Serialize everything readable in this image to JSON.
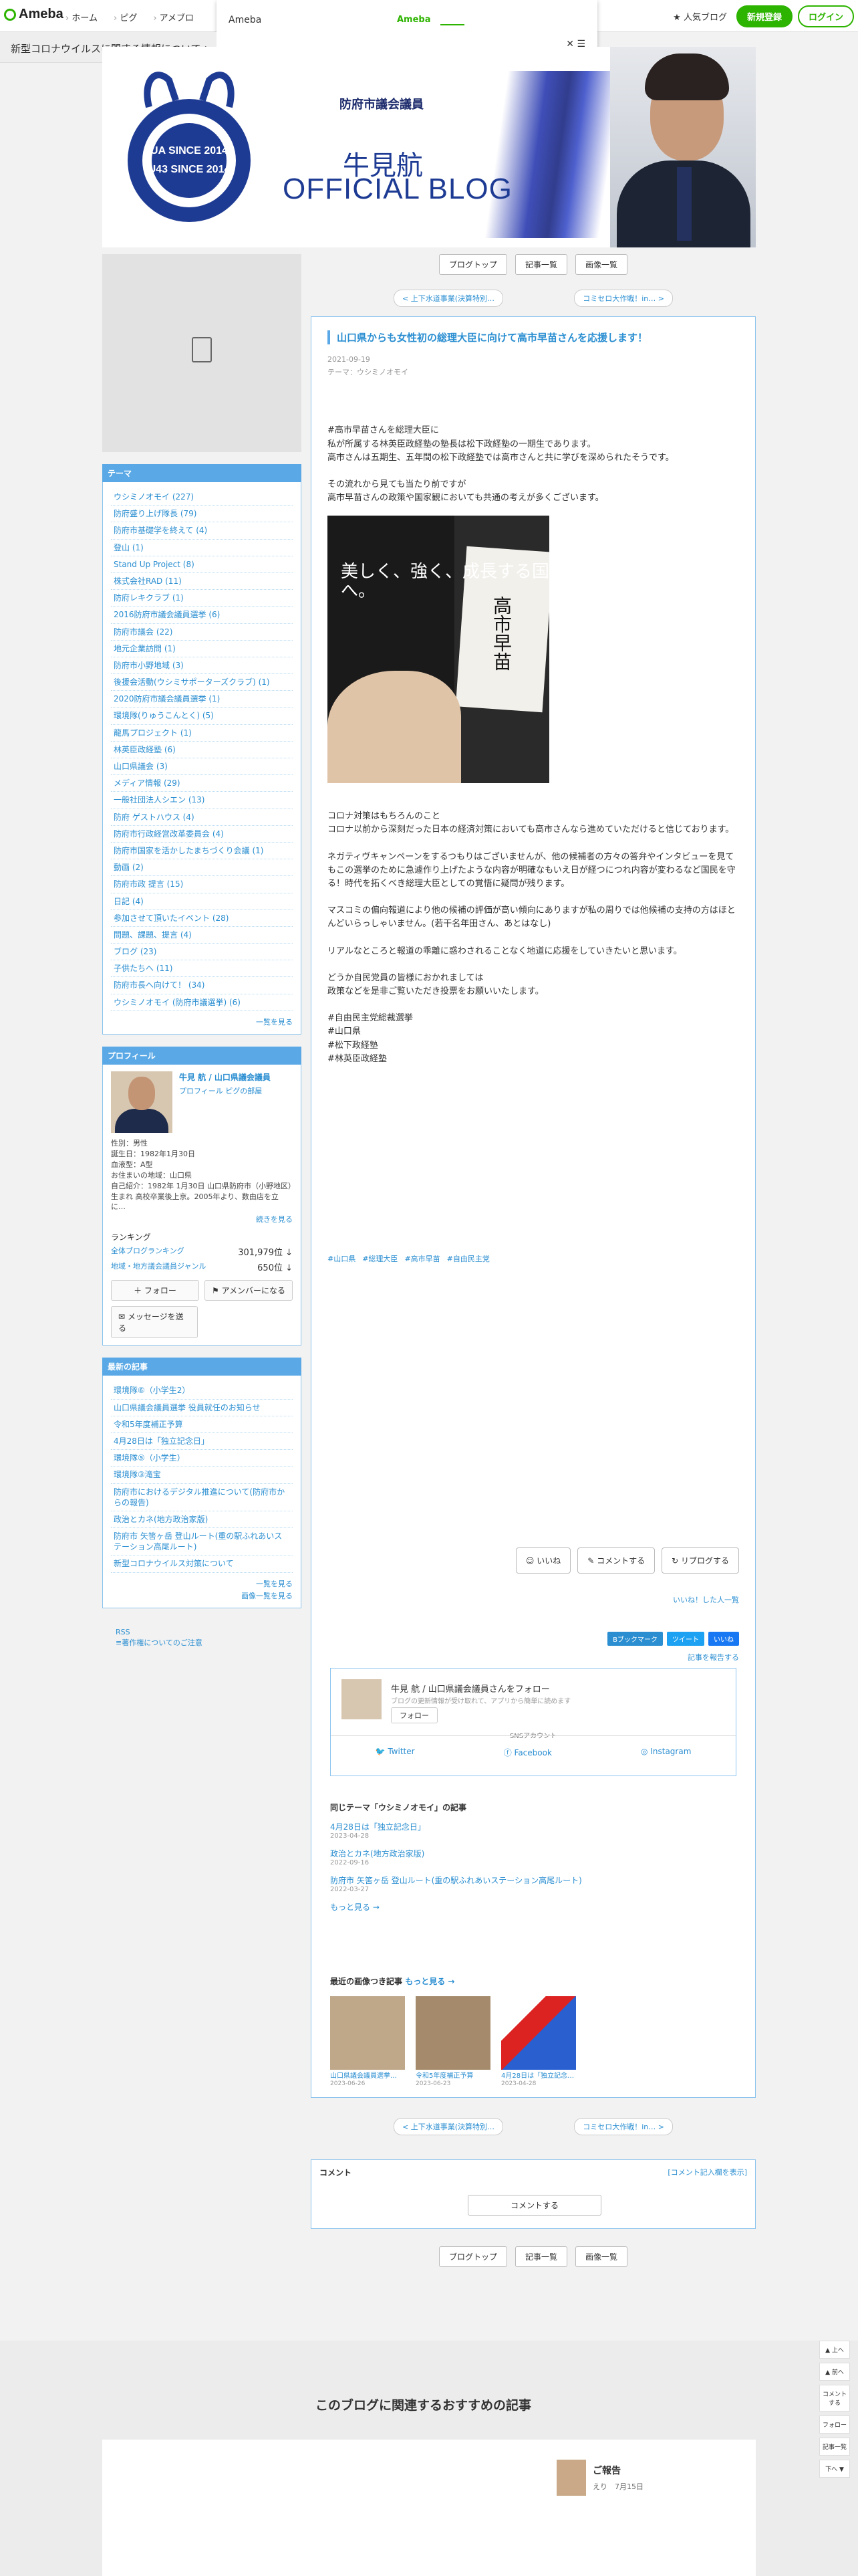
{
  "topbar": {
    "logo": "Ameba",
    "nav": [
      "ホーム",
      "ピグ",
      "アメブロ"
    ],
    "popular": "人気ブログ",
    "signup": "新規登録",
    "login": "ログイン"
  },
  "popup": {
    "title": "Ameba",
    "user": "Ameba",
    "close": "✕ ☰"
  },
  "news": "新型コロナウイルスに関する情報について  >",
  "header": {
    "seal_top": "UA SINCE 2014",
    "seal_bottom": "U43 SINCE 2014",
    "subtitle": "防府市議会議員",
    "name": "牛見航",
    "title": "OFFICIAL BLOG"
  },
  "theme": {
    "heading": "テーマ",
    "items": [
      "ウシミノオモイ (227)",
      "防府盛り上げ隊長 (79)",
      "防府市基礎学を終えて (4)",
      "登山 (1)",
      "Stand Up Project (8)",
      "株式会社RAD (11)",
      "防府レキクラブ (1)",
      "2016防府市議会議員選挙 (6)",
      "防府市議会 (22)",
      "地元企業訪問 (1)",
      "防府市小野地域 (3)",
      "後援会活動(ウシミサポーターズクラブ) (1)",
      "2020防府市議会議員選挙 (1)",
      "環境隊(りゅうこんとく) (5)",
      "龍馬プロジェクト (1)",
      "林英臣政経塾 (6)",
      "山口県議会 (3)",
      "メディア情報 (29)",
      "一般社団法人シエン (13)",
      "防府 ゲストハウス (4)",
      "防府市行政経営改革委員会 (4)",
      "防府市国家を活かしたまちづくり会議 (1)",
      "動画 (2)",
      "防府市政 提言 (15)",
      "日記 (4)",
      "参加させて頂いたイベント (28)",
      "問題、課題、提言 (4)",
      "ブログ (23)",
      "子供たちへ (11)",
      "防府市長へ向けて！ (34)",
      "ウシミノオモイ (防府市議選挙) (6)"
    ],
    "more": "一覧を見る"
  },
  "profile": {
    "heading": "プロフィール",
    "name": "牛見 航 / 山口県議会議員",
    "links": "プロフィール  ピグの部屋",
    "info": "性別：男性\n誕生日：1982年1月30日\n血液型：A型\nお住まいの地域：山口県\n自己紹介：1982年 1月30日 山口県防府市（小野地区）生まれ 高校卒業後上京。2005年より、数由店を立に…",
    "info_more": "続きを見る",
    "rank_heading": "ランキング",
    "rank1_label": "全体ブログランキング",
    "rank1_val": "301,979位 ↓",
    "rank2_label": "地域・地方議会議員ジャンル",
    "rank2_val": "650位 ↓",
    "follow": "フォロー",
    "member": "アメンバーになる",
    "message": "メッセージを送る"
  },
  "recent": {
    "heading": "最新の記事",
    "items": [
      "環境隊⑥（小学生2）",
      "山口県議会議員選挙 役員就任のお知らせ",
      "令和5年度補正予算",
      "4月28日は「独立記念日」",
      "環境隊⑤（小学生）",
      "環境隊③滝宝",
      "防府市におけるデジタル推進について(防府市からの報告)",
      "政治とカネ(地方政治家版)",
      "防府市 矢筈ヶ岳 登山ルート(重の駅ふれあいステーション高尾ルート)",
      "新型コロナウイルス対策について"
    ],
    "more": "一覧を見る",
    "images": "画像一覧を見る"
  },
  "rss": {
    "label": "RSS",
    "note": "≡著作権についてのご注意"
  },
  "main": {
    "tabs": [
      "ブログトップ",
      "記事一覧",
      "画像一覧"
    ],
    "prev": "< 上下水道事業(決算特別…",
    "next": "コミセロ大作戦！in… >"
  },
  "article": {
    "title": "山口県からも女性初の総理大臣に向けて高市早苗さんを応援します！",
    "date": "2021-09-19",
    "theme": "テーマ：ウシミノオモイ",
    "body1": "#高市早苗さんを総理大臣に\n私が所属する林英臣政経塾の塾長は松下政経塾の一期生であります。\n高市さんは五期生、五年間の松下政経塾では高市さんと共に学びを深められたそうです。\n\nその流れから見ても当たり前ですが\n高市早苗さんの政策や国家観においても共通の考えが多くございます。",
    "book_left": "美しく、強く、成長する国へ。",
    "book_right": "高市早苗",
    "body2": "コロナ対策はもちろんのこと\nコロナ以前から深刻だった日本の経済対策においても高市さんなら進めていただけると信じております。\n\nネガティヴキャンペーンをするつもりはございませんが、他の候補者の方々の答弁やインタビューを見てもこの選挙のために急遽作り上げたような内容が明確なもいえ日が経つにつれ内容が変わるなど国民を守る！時代を拓くべき総理大臣としての覚悟に疑問が残ります。\n\nマスコミの偏向報道により他の候補の評価が高い傾向にありますが私の周りでは他候補の支持の方はほとんどいらっしゃいません。(若干名年田さん、あとはなし)\n\nリアルなところと報道の乖離に惑わされることなく地道に応援をしていきたいと思います。\n\nどうか自民党員の皆様におかれましては\n政策などを是非ご覧いただき投票をお願いいたします。\n\n#自由民主党総裁選挙\n#山口県\n#松下政経塾\n#林英臣政経塾",
    "hashtags": [
      "#山口県",
      "#総理大臣",
      "#高市早苗",
      "#自由民主党"
    ],
    "like": "いいね",
    "comment": "コメントする",
    "reblog": "リブログする",
    "likers": "いいね！した人一覧",
    "share": [
      "Bブックマーク",
      "ツイート",
      "いいね"
    ],
    "report": "記事を報告する",
    "follow_name": "牛見 航 / 山口県議会議員さんをフォロー",
    "follow_desc": "ブログの更新情報が受け取れて、アプリから簡単に読めます",
    "follow_btn": "フォロー",
    "sns_heading": "SNSアカウント",
    "sns": [
      "Twitter",
      "Facebook",
      "Instagram"
    ],
    "same_theme": "同じテーマ「ウシミノオモイ」の記事",
    "same_items": [
      {
        "title": "4月28日は「独立記念日」",
        "date": "2023-04-28"
      },
      {
        "title": "政治とカネ(地方政治家版)",
        "date": "2022-09-16"
      },
      {
        "title": "防府市 矢筈ヶ岳 登山ルート(重の駅ふれあいステーション高尾ルート)",
        "date": "2022-03-27"
      }
    ],
    "same_more": "もっと見る →",
    "recent_heading": "最近の画像つき記事",
    "recent_more": "もっと見る →",
    "thumbs": [
      {
        "title": "山口県議会議員選挙…",
        "date": "2023-06-26"
      },
      {
        "title": "令和5年度補正予算",
        "date": "2023-06-23"
      },
      {
        "title": "4月28日は「独立記念…",
        "date": "2023-04-28"
      }
    ]
  },
  "comment": {
    "heading": "コメント",
    "link": "[コメント記入欄を表示]",
    "button": "コメントする"
  },
  "rail": [
    "▲ 上へ",
    "▲ 前へ",
    "コメントする",
    "フォロー",
    "記事一覧",
    "下へ ▼"
  ],
  "recommend": {
    "title": "このブログに関連するおすすめの記事",
    "name": "ご報告",
    "sub": "えり　7月15日"
  },
  "colors": {
    "accent": "#5aa9e6",
    "green": "#2db400",
    "link": "#2a8ed1"
  }
}
